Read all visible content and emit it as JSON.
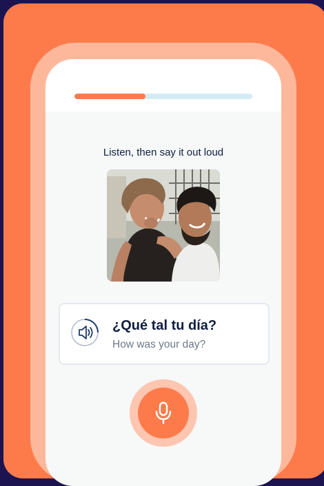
{
  "lesson": {
    "progress": 0.4,
    "instruction": "Listen, then say it out loud",
    "phrase": "¿Qué tal tu día?",
    "translation": "How was your day?"
  },
  "icons": {
    "audio": "speaker-icon",
    "mic": "microphone-icon"
  },
  "colors": {
    "accent": "#fd7b4b",
    "accent_light": "#fdb89c",
    "background": "#1b1450",
    "progress_track": "#d4ebf4",
    "text_primary": "#0f1e3d",
    "text_secondary": "#6c7a8a"
  }
}
